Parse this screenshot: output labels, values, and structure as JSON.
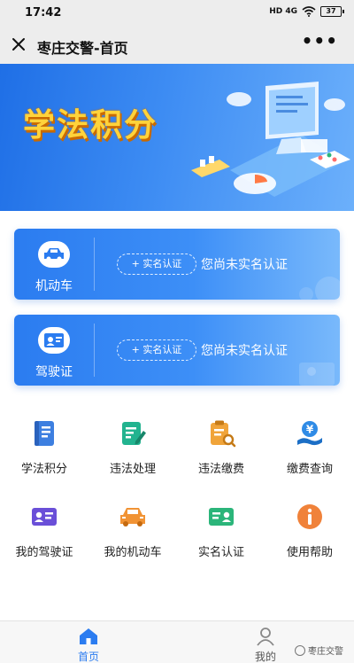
{
  "status_bar": {
    "time": "17:42",
    "signal": "HD 4G",
    "battery": "37"
  },
  "nav": {
    "title": "枣庄交警-首页",
    "close_icon": "close-icon",
    "more_icon": "more-icon"
  },
  "banner": {
    "title": "学法积分"
  },
  "cards": [
    {
      "label": "机动车",
      "icon": "car-icon",
      "button": "+ 实名认证",
      "status": "您尚未实名认证"
    },
    {
      "label": "驾驶证",
      "icon": "license-icon",
      "button": "+ 实名认证",
      "status": "您尚未实名认证"
    }
  ],
  "services": [
    {
      "label": "学法积分",
      "icon": "book-icon",
      "color": "#3d7fe0"
    },
    {
      "label": "违法处理",
      "icon": "edit-document-icon",
      "color": "#22b38f"
    },
    {
      "label": "违法缴费",
      "icon": "clipboard-search-icon",
      "color": "#f0a43a"
    },
    {
      "label": "缴费查询",
      "icon": "yuan-hand-icon",
      "color": "#2f8be6"
    },
    {
      "label": "我的驾驶证",
      "icon": "id-card-icon",
      "color": "#6a4fd8"
    },
    {
      "label": "我的机动车",
      "icon": "car-icon",
      "color": "#f19334"
    },
    {
      "label": "实名认证",
      "icon": "user-card-icon",
      "color": "#2bb57a"
    },
    {
      "label": "使用帮助",
      "icon": "info-icon",
      "color": "#f0823a"
    }
  ],
  "tabbar": {
    "items": [
      {
        "label": "首页",
        "icon": "home-icon",
        "active": true
      },
      {
        "label": "我的",
        "icon": "person-icon",
        "active": false
      }
    ],
    "watermark": "枣庄交警"
  },
  "colors": {
    "primary": "#2b7cf0",
    "banner_title": "#ffd33b",
    "tab_active": "#2b7cf0"
  }
}
